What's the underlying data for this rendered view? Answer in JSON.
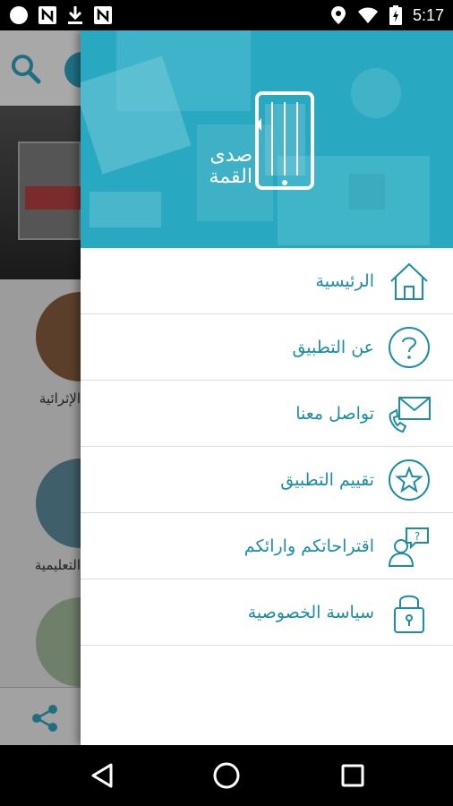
{
  "status_bar": {
    "time": "5:17",
    "icons": [
      "circle-icon",
      "nfc-icon",
      "download-icon",
      "nfc-icon",
      "location-icon",
      "wifi-icon",
      "battery-icon"
    ]
  },
  "background_app": {
    "categories": [
      {
        "label": "الإثرائية"
      },
      {
        "label": "التعليمية"
      }
    ],
    "icons": [
      "search-icon",
      "share-icon"
    ]
  },
  "drawer": {
    "brand": {
      "line1": "صدى",
      "line2": "القمة"
    },
    "accent_color": "#29a9c1",
    "text_color": "#1b8ea6",
    "menu": [
      {
        "label": "الرئيسية",
        "icon": "home-icon"
      },
      {
        "label": "عن التطبيق",
        "icon": "question-icon"
      },
      {
        "label": "تواصل معنا",
        "icon": "contact-icon"
      },
      {
        "label": "تقييم التطبيق",
        "icon": "star-icon"
      },
      {
        "label": "اقتراحاتكم وارائكم",
        "icon": "feedback-icon"
      },
      {
        "label": "سياسة الخصوصية",
        "icon": "lock-icon"
      }
    ]
  },
  "nav_bar": {
    "icons": [
      "back-icon",
      "home-circle-icon",
      "recents-icon"
    ]
  }
}
